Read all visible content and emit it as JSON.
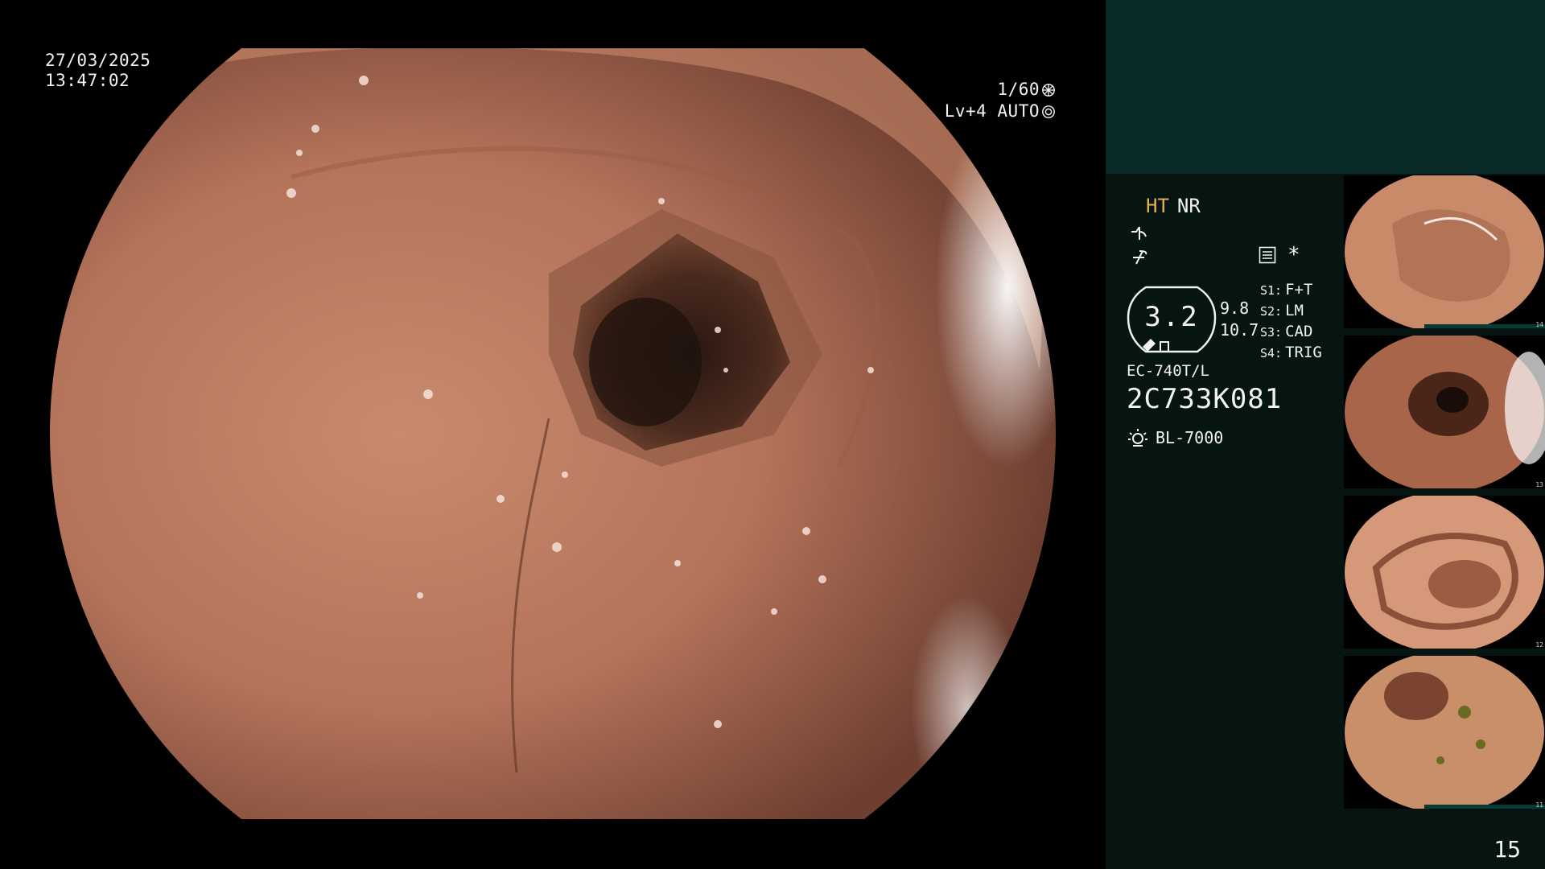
{
  "osd": {
    "date": "27/03/2025",
    "time": "13:47:02",
    "shutter": "1/60",
    "level": "Lv+4 AUTO"
  },
  "icons": {
    "shutter_icon": "aperture-icon",
    "auto_icon": "iris-icon",
    "filter_icon": "contrast-icon",
    "enhance_icon": "sharpness-icon",
    "settings_icon": "settings-list-icon",
    "lamp_icon": "light-source-icon"
  },
  "processor": {
    "mode_ht": "HT",
    "mode_nr": "NR",
    "star": "*",
    "ring_value": "3.2",
    "value_a": "9.8",
    "value_b": "10.7",
    "slots": [
      {
        "key": "S1:",
        "value": "F+T"
      },
      {
        "key": "S2:",
        "value": "LM"
      },
      {
        "key": "S3:",
        "value": "CAD"
      },
      {
        "key": "S4:",
        "value": "TRIG"
      }
    ],
    "model": "EC-740T/L",
    "serial": "2C733K081",
    "light_source": "BL-7000"
  },
  "thumbnails": [
    {
      "num": "14"
    },
    {
      "num": "13"
    },
    {
      "num": "12"
    },
    {
      "num": "11"
    }
  ],
  "page_number": "15",
  "colors": {
    "ht_accent": "#e6b04a",
    "side_panel_top": "#0a2a28",
    "side_panel": "#061412",
    "mucosa": "#c47d5d"
  }
}
